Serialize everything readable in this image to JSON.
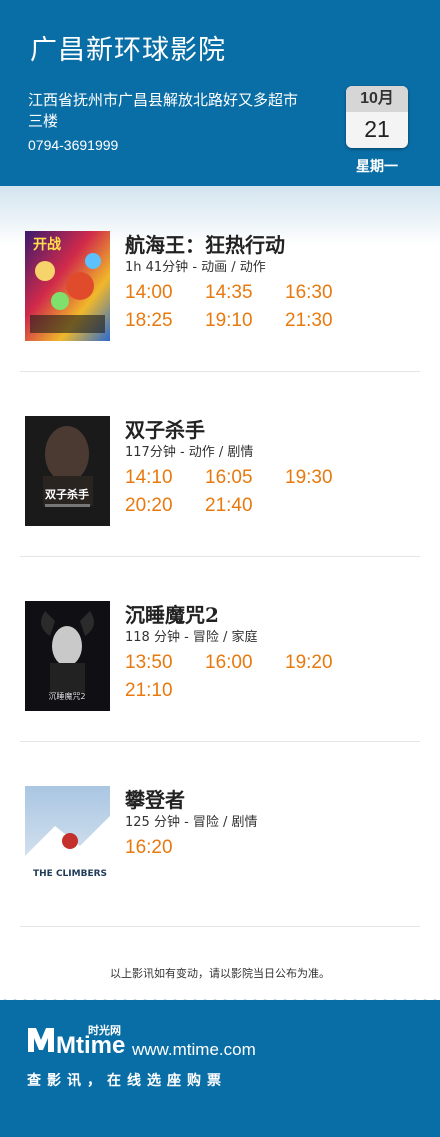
{
  "header": {
    "cinema_name": "广昌新环球影院",
    "address_line1": "江西省抚州市广昌县解放北路好又多超市",
    "address_line2": "三楼",
    "phone": "0794-3691999",
    "date_month": "10月",
    "date_day": "21",
    "weekday": "星期一"
  },
  "movies": [
    {
      "title": "航海王：狂热行动",
      "meta": "1h 41分钟 - 动画 / 动作",
      "times": [
        "14:00",
        "14:35",
        "16:30",
        "18:25",
        "19:10",
        "21:30"
      ],
      "poster_text": "开战"
    },
    {
      "title": "双子杀手",
      "meta": "117分钟 - 动作 / 剧情",
      "times": [
        "14:10",
        "16:05",
        "19:30",
        "20:20",
        "21:40"
      ],
      "poster_text": "双子杀手"
    },
    {
      "title": "沉睡魔咒2",
      "meta": "118 分钟 - 冒险 / 家庭",
      "times": [
        "13:50",
        "16:00",
        "19:20",
        "21:10"
      ],
      "poster_text": "沉睡魔咒2"
    },
    {
      "title": "攀登者",
      "meta": "125 分钟 - 冒险 / 剧情",
      "times": [
        "16:20"
      ],
      "poster_text": "THE CLIMBERS"
    }
  ],
  "notice": "以上影讯如有变动，请以影院当日公布为准。",
  "footer": {
    "brand": "时光网",
    "logo_text": "Mtime",
    "url": "www.mtime.com",
    "slogan": "查影讯，在线选座购票"
  },
  "colors": {
    "header_blue": "#0a6ea6",
    "time_orange": "#e8790e"
  }
}
